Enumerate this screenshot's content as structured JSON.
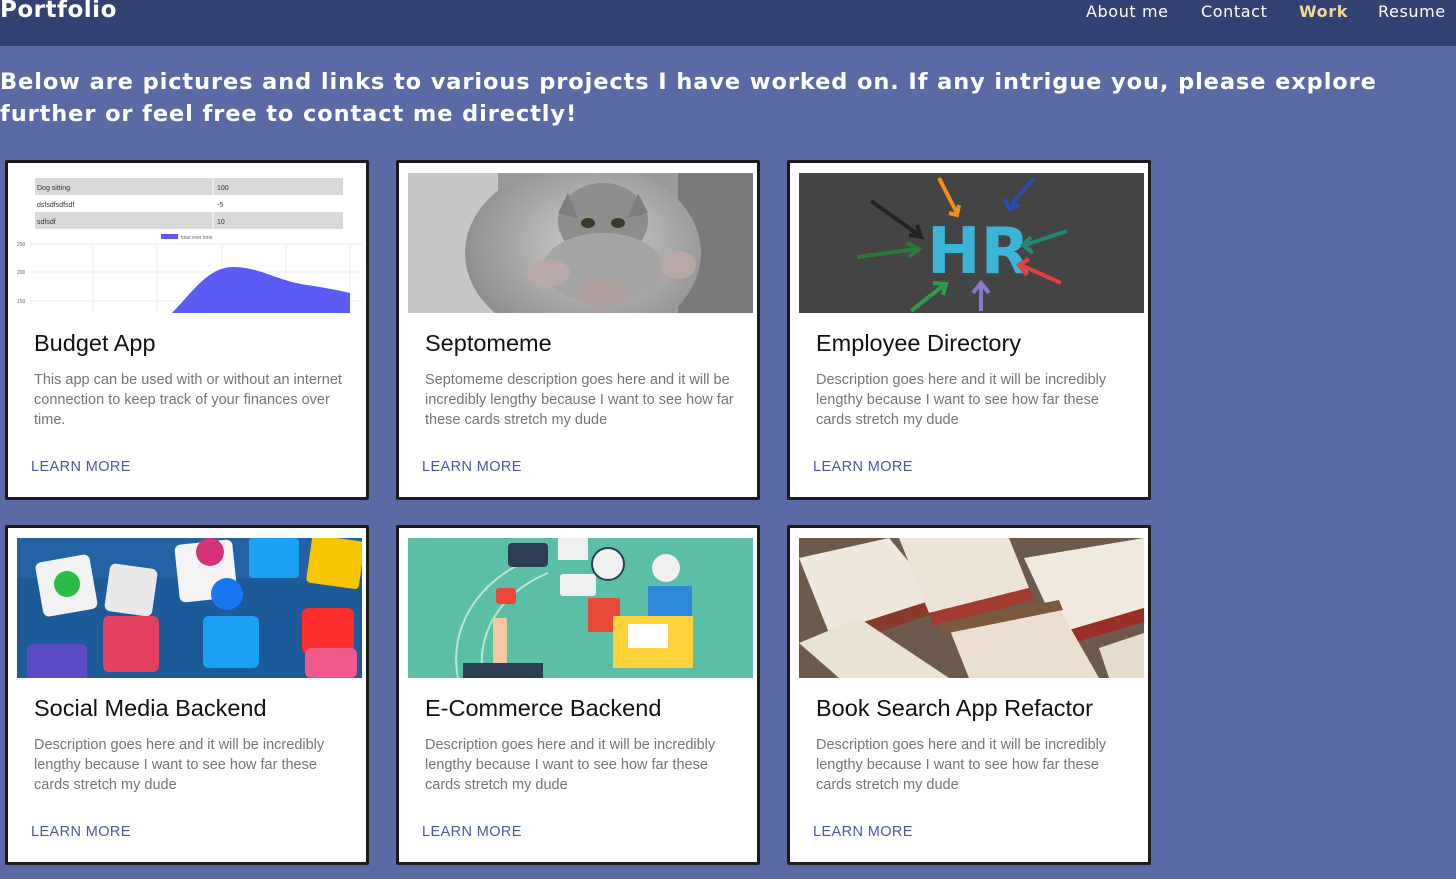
{
  "nav": {
    "brand": "Portfolio",
    "links": [
      {
        "label": "About me"
      },
      {
        "label": "Contact"
      },
      {
        "label": "Work",
        "active": true
      },
      {
        "label": "Resume"
      }
    ]
  },
  "intro": "Below are pictures and links to various projects I have worked on. If any intrigue you, please explore further or feel free to contact me directly!",
  "cards": [
    {
      "title": "Budget App",
      "description": "This app can be used with or without an internet connection to keep track of your finances over time.",
      "link": "LEARN MORE",
      "thumbnail": {
        "rows": [
          [
            "Dog sitting",
            "100"
          ],
          [
            "dsfsdfsdfsdf",
            "-5"
          ],
          [
            "sdfsdf",
            "10"
          ]
        ],
        "legend": "total over time",
        "y_ticks": [
          "250",
          "200",
          "150"
        ]
      }
    },
    {
      "title": "Septomeme",
      "description": "Septomeme description goes here and it will be incredibly lengthy because I want to see how far these cards stretch my dude",
      "link": "LEARN MORE"
    },
    {
      "title": "Employee Directory",
      "description": "Description goes here and it will be incredibly lengthy because I want to see how far these cards stretch my dude",
      "link": "LEARN MORE",
      "thumbnail": {
        "text": "HR"
      }
    },
    {
      "title": "Social Media Backend",
      "description": "Description goes here and it will be incredibly lengthy because I want to see how far these cards stretch my dude",
      "link": "LEARN MORE"
    },
    {
      "title": "E-Commerce Backend",
      "description": "Description goes here and it will be incredibly lengthy because I want to see how far these cards stretch my dude",
      "link": "LEARN MORE"
    },
    {
      "title": "Book Search App Refactor",
      "description": "Description goes here and it will be incredibly lengthy because I want to see how far these cards stretch my dude",
      "link": "LEARN MORE"
    }
  ],
  "colors": {
    "nav_bg": "#324272",
    "page_bg": "#5a6aa5",
    "active_link": "#f3d79a",
    "learn_more": "#4a57a8",
    "chart_fill": "#5b5bf5"
  }
}
